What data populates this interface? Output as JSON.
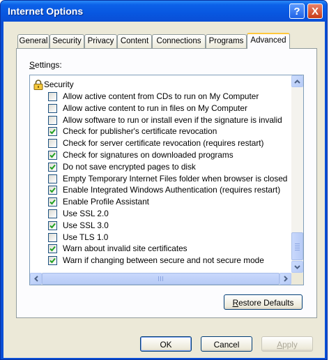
{
  "window": {
    "title": "Internet Options",
    "help_glyph": "?",
    "close_glyph": "X"
  },
  "tabs": [
    {
      "label": "General",
      "active": false
    },
    {
      "label": "Security",
      "active": false
    },
    {
      "label": "Privacy",
      "active": false
    },
    {
      "label": "Content",
      "active": false
    },
    {
      "label": "Connections",
      "active": false
    },
    {
      "label": "Programs",
      "active": false
    },
    {
      "label": "Advanced",
      "active": true
    }
  ],
  "settings": {
    "label_hotkey": "S",
    "label_rest": "ettings:",
    "group_label": "Security",
    "group_icon": "lock-icon",
    "items": [
      {
        "label": "Allow active content from CDs to run on My Computer",
        "checked": false
      },
      {
        "label": "Allow active content to run in files on My Computer",
        "checked": false
      },
      {
        "label": "Allow software to run or install even if the signature is invalid",
        "checked": false
      },
      {
        "label": "Check for publisher's certificate revocation",
        "checked": true
      },
      {
        "label": "Check for server certificate revocation (requires restart)",
        "checked": false
      },
      {
        "label": "Check for signatures on downloaded programs",
        "checked": true
      },
      {
        "label": "Do not save encrypted pages to disk",
        "checked": true
      },
      {
        "label": "Empty Temporary Internet Files folder when browser is closed",
        "checked": false
      },
      {
        "label": "Enable Integrated Windows Authentication (requires restart)",
        "checked": true
      },
      {
        "label": "Enable Profile Assistant",
        "checked": true
      },
      {
        "label": "Use SSL 2.0",
        "checked": false
      },
      {
        "label": "Use SSL 3.0",
        "checked": true
      },
      {
        "label": "Use TLS 1.0",
        "checked": false
      },
      {
        "label": "Warn about invalid site certificates",
        "checked": true
      },
      {
        "label": "Warn if changing between secure and not secure mode",
        "checked": true
      }
    ]
  },
  "buttons": {
    "restore_hotkey": "R",
    "restore_rest": "estore Defaults",
    "ok": "OK",
    "cancel": "Cancel",
    "apply_hotkey": "A",
    "apply_rest": "pply"
  },
  "colors": {
    "titlebar": "#0a4fd6",
    "dialog_face": "#ece9d8",
    "checkmark": "#21a121",
    "active_tab_accent": "#ffc83c"
  }
}
